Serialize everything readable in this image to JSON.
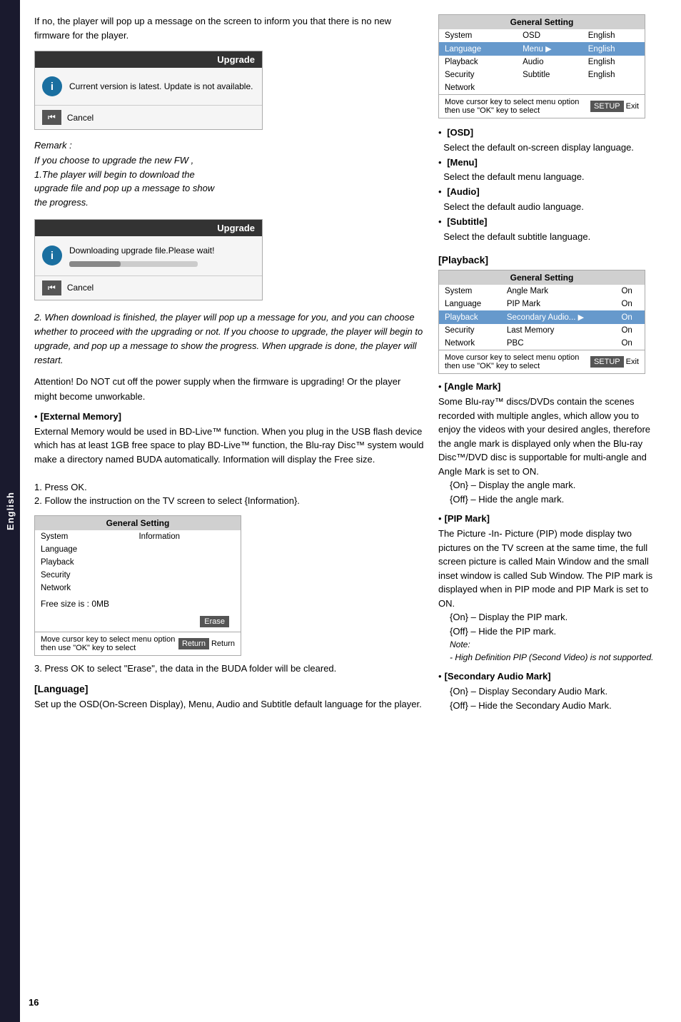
{
  "sidebar": {
    "label": "English"
  },
  "page": {
    "number": "16"
  },
  "upgrade_box1": {
    "header": "Upgrade",
    "icon": "i",
    "body_text": "Current version is latest. Update is not available.",
    "cancel_label": "Cancel"
  },
  "remark": {
    "title": "Remark :",
    "line1": "If you choose to upgrade the new FW ,",
    "line2": "1.The player will begin to download the",
    "line3": "upgrade file and pop up a message to show",
    "line4": "the progress."
  },
  "upgrade_box2": {
    "header": "Upgrade",
    "icon": "i",
    "body_text": "Downloading upgrade file.Please wait!",
    "cancel_label": "Cancel"
  },
  "body_text1": {
    "lines": [
      "2. When download is finished, the player will",
      "pop up a message for you, and you can choose",
      "whether to proceed with the upgrading or not.",
      "If you choose to upgrade, the player will begin",
      "to upgrade, and pop up a message to show the",
      "progress. When upgrade is done, the player",
      "will restart."
    ]
  },
  "attention_text": "Attention! Do NOT cut off the power supply when the firmware is upgrading! Or the player might become unworkable.",
  "external_memory": {
    "bullet": "•",
    "title": "[External Memory]",
    "desc_lines": [
      "External Memory would be used in BD-Live™ function. When you plug in the USB flash device which has at least 1GB free space to play BD-Live™ function, the Blu-ray Disc™ system would make a directory named BUDA automatically. Information will display the Free size.",
      "1. Press OK.",
      "2. Follow the instruction on the TV screen to select {Information}."
    ]
  },
  "info_setting_box": {
    "header": "General Setting",
    "rows": [
      {
        "label": "System",
        "value": "Information",
        "highlighted": false
      },
      {
        "label": "Language",
        "value": "",
        "highlighted": false
      },
      {
        "label": "Playback",
        "value": "",
        "highlighted": false
      },
      {
        "label": "Security",
        "value": "",
        "highlighted": false
      },
      {
        "label": "Network",
        "value": "",
        "highlighted": false
      }
    ],
    "free_size": "Free size is : 0MB",
    "erase_btn": "Erase",
    "footer_text": "Move cursor key to select menu option then use \"OK\" key to select",
    "return_btn": "Return",
    "return_label": "Return"
  },
  "step3_text": "3. Press OK to select \"Erase\", the data in the BUDA folder will be cleared.",
  "language_section": {
    "heading": "[Language]",
    "desc": "Set up the OSD(On-Screen Display), Menu, Audio and Subtitle default language for the player."
  },
  "general_setting_box1": {
    "header": "General Setting",
    "rows": [
      {
        "label": "System",
        "col2": "OSD",
        "col3": "English",
        "highlighted": false
      },
      {
        "label": "Language",
        "col2": "Menu",
        "col3": "English",
        "highlighted": true
      },
      {
        "label": "Playback",
        "col2": "Audio",
        "col3": "English",
        "highlighted": false
      },
      {
        "label": "Security",
        "col2": "Subtitle",
        "col3": "English",
        "highlighted": false
      },
      {
        "label": "Network",
        "col2": "",
        "col3": "",
        "highlighted": false
      }
    ],
    "footer_text": "Move cursor key to select menu option then use \"OK\" key to select",
    "setup_label": "SETUP",
    "exit_label": "Exit"
  },
  "osd_items": [
    {
      "label": "[OSD]",
      "desc": "Select the default on-screen display language."
    },
    {
      "label": "[Menu]",
      "desc": "Select the default menu language."
    },
    {
      "label": "[Audio]",
      "desc": "Select the default audio language."
    },
    {
      "label": "[Subtitle]",
      "desc": "Select the default subtitle language."
    }
  ],
  "playback_heading": "[Playback]",
  "general_setting_box2": {
    "header": "General Setting",
    "rows": [
      {
        "label": "System",
        "col2": "Angle Mark",
        "col3": "On",
        "highlighted": false
      },
      {
        "label": "Language",
        "col2": "PIP Mark",
        "col3": "On",
        "highlighted": false
      },
      {
        "label": "Playback",
        "col2": "Secondary Audio...",
        "col3": "On",
        "highlighted": true
      },
      {
        "label": "Security",
        "col2": "Last Memory",
        "col3": "On",
        "highlighted": false
      },
      {
        "label": "Network",
        "col2": "PBC",
        "col3": "On",
        "highlighted": false
      }
    ],
    "footer_text": "Move cursor key to select menu option then use \"OK\" key to select",
    "setup_label": "SETUP",
    "exit_label": "Exit"
  },
  "angle_mark": {
    "bullet": "•",
    "title": "[Angle Mark]",
    "desc": "Some Blu-ray™ discs/DVDs contain the scenes recorded with multiple angles, which allow you to enjoy the videos with your desired angles, therefore the angle mark is displayed only when the Blu-ray Disc™/DVD disc is supportable for multi-angle and Angle Mark is set to ON.",
    "on_text": "{On} – Display the angle mark.",
    "off_text": "{Off} – Hide the angle mark."
  },
  "pip_mark": {
    "bullet": "•",
    "title": "[PIP Mark]",
    "desc": "The Picture -In- Picture (PIP) mode display two pictures on the TV screen at the same time, the full screen picture is called Main Window and the small inset window is called Sub Window. The PIP mark is displayed when in PIP mode and PIP Mark is set to ON.",
    "on_text": "{On} – Display the PIP mark.",
    "off_text": "{Off} – Hide the PIP mark.",
    "note": "Note:",
    "note_detail": "- High Definition PIP (Second Video) is not supported."
  },
  "secondary_audio": {
    "bullet": "•",
    "title": "[Secondary Audio Mark]",
    "on_text": "{On} – Display Secondary Audio Mark.",
    "off_text": "{Off} – Hide the Secondary Audio Mark."
  }
}
